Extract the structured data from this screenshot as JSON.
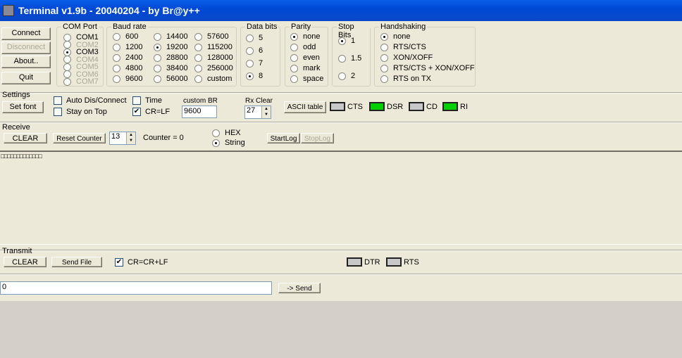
{
  "window": {
    "title": "Terminal v1.9b - 20040204 - by Br@y++"
  },
  "buttons": {
    "connect": "Connect",
    "disconnect": "Disconnect",
    "about": "About..",
    "quit": "Quit"
  },
  "com_port": {
    "label": "COM Port",
    "options": [
      {
        "label": "COM1",
        "selected": false,
        "enabled": true
      },
      {
        "label": "COM2",
        "selected": false,
        "enabled": false
      },
      {
        "label": "COM3",
        "selected": true,
        "enabled": true
      },
      {
        "label": "COM4",
        "selected": false,
        "enabled": false
      },
      {
        "label": "COM5",
        "selected": false,
        "enabled": false
      },
      {
        "label": "COM6",
        "selected": false,
        "enabled": false
      },
      {
        "label": "COM7",
        "selected": false,
        "enabled": false
      }
    ]
  },
  "baud_rate": {
    "label": "Baud rate",
    "options": [
      "600",
      "1200",
      "2400",
      "4800",
      "9600",
      "14400",
      "19200",
      "28800",
      "38400",
      "56000",
      "57600",
      "115200",
      "128000",
      "256000",
      "custom"
    ],
    "selected": "19200"
  },
  "data_bits": {
    "label": "Data bits",
    "options": [
      "5",
      "6",
      "7",
      "8"
    ],
    "selected": "8"
  },
  "parity": {
    "label": "Parity",
    "options": [
      "none",
      "odd",
      "even",
      "mark",
      "space"
    ],
    "selected": "none"
  },
  "stop_bits": {
    "label": "Stop Bits",
    "options": [
      "1",
      "1.5",
      "2"
    ],
    "selected": "1"
  },
  "handshaking": {
    "label": "Handshaking",
    "options": [
      "none",
      "RTS/CTS",
      "XON/XOFF",
      "RTS/CTS + XON/XOFF",
      "RTS on TX"
    ],
    "selected": "none"
  },
  "settings": {
    "label": "Settings",
    "set_font": "Set font",
    "auto_dis_connect": "Auto Dis/Connect",
    "stay_on_top": "Stay on Top",
    "time": "Time",
    "cr_lf": "CR=LF",
    "custom_br_label": "custom BR",
    "custom_br_value": "9600",
    "rx_clear_label": "Rx Clear",
    "rx_clear_value": "27",
    "ascii_table": "ASCII table",
    "leds": [
      {
        "label": "CTS",
        "on": false
      },
      {
        "label": "DSR",
        "on": true
      },
      {
        "label": "CD",
        "on": false
      },
      {
        "label": "RI",
        "on": true
      }
    ],
    "colors": {
      "led_on": "#00d000",
      "led_off": "#c8c8c8"
    }
  },
  "receive": {
    "label": "Receive",
    "clear": "CLEAR",
    "reset_counter": "Reset Counter",
    "counter_spin": "13",
    "counter_text": "Counter = 0",
    "hex": "HEX",
    "string": "String",
    "start_log": "StartLog",
    "stop_log": "StopLog",
    "content": "□□□□□□□□□□□□□"
  },
  "transmit": {
    "label": "Transmit",
    "clear": "CLEAR",
    "send_file": "Send File",
    "cr_crlf": "CR=CR+LF",
    "leds": [
      {
        "label": "DTR",
        "on": false
      },
      {
        "label": "RTS",
        "on": false
      }
    ],
    "input_value": "0",
    "send": "-> Send"
  }
}
